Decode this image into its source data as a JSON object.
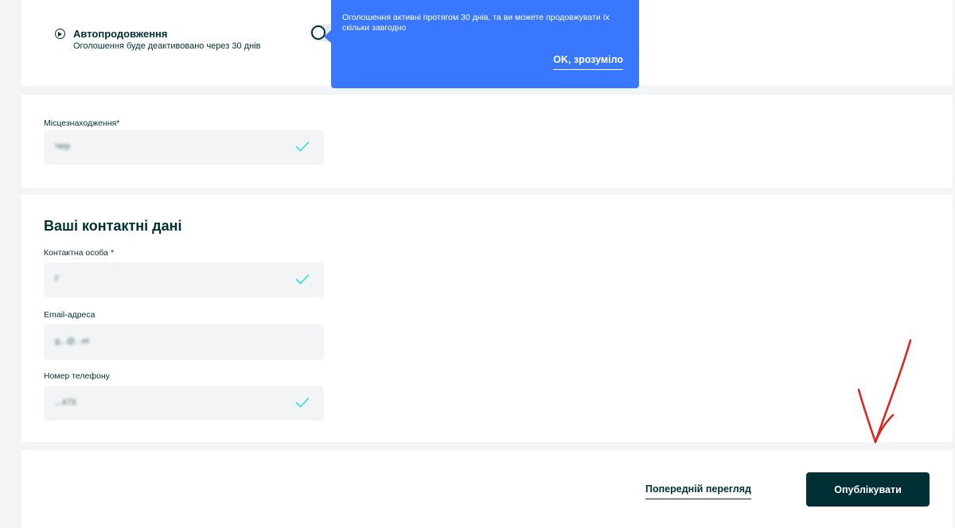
{
  "autorenew": {
    "title": "Автопродовження",
    "description": "Оголошення буде деактивовано через 30 днів",
    "toggle_on": false
  },
  "tooltip": {
    "text": "Оголошення активні протягом 30 днів, та ви можете продовжувати їх скільки завгодно",
    "ok_label": "OK, зрозуміло"
  },
  "location": {
    "label": "Місцезнаходження*",
    "value": "Чер"
  },
  "contacts": {
    "title": "Ваші контактні дані",
    "person_label": "Контактна особа *",
    "person_value": "Г",
    "email_label": "Email-адреса",
    "email_value": "g...@...et",
    "phone_label": "Номер телефону",
    "phone_value": "...473"
  },
  "footer": {
    "preview_label": "Попередній перегляд",
    "publish_label": "Опублікувати"
  },
  "colors": {
    "tooltip_bg": "#3a77ff",
    "primary": "#002f34",
    "check": "#23e5db",
    "annotation": "#e0201d"
  }
}
